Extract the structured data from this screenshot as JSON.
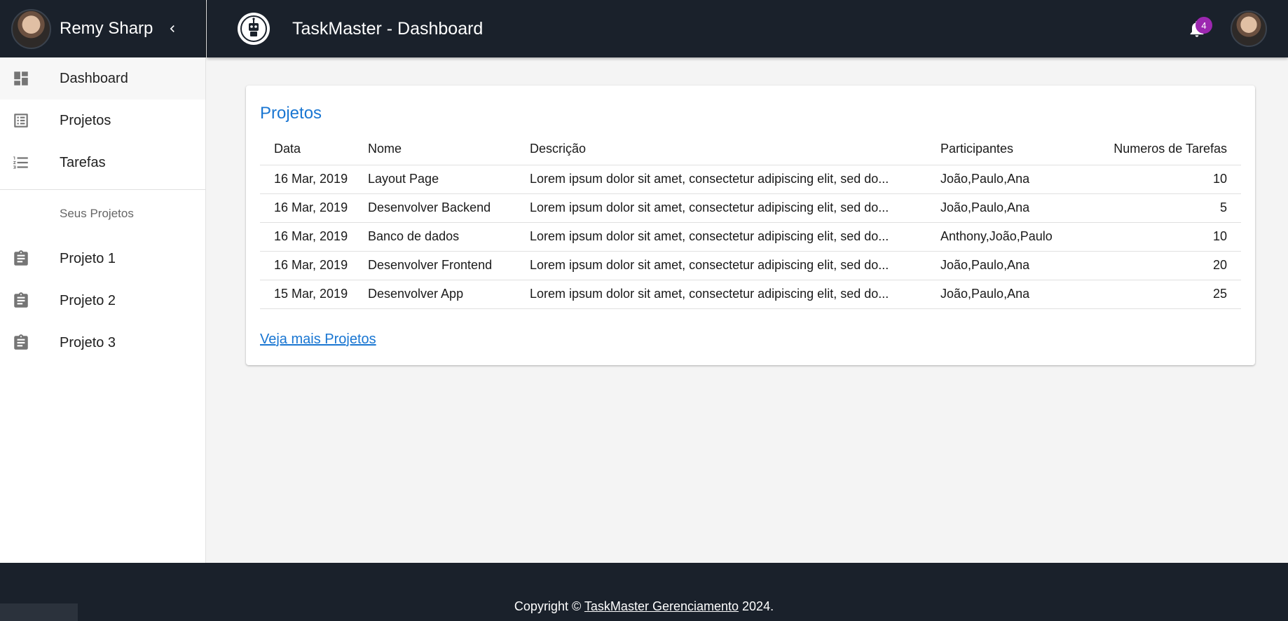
{
  "sidebar": {
    "user_name": "Remy Sharp",
    "nav": [
      {
        "label": "Dashboard",
        "icon": "dashboard-icon"
      },
      {
        "label": "Projetos",
        "icon": "list-alt-icon"
      },
      {
        "label": "Tarefas",
        "icon": "format-list-numbered-icon"
      }
    ],
    "section_label": "Seus Projetos",
    "projects": [
      {
        "label": "Projeto 1",
        "icon": "assignment-icon"
      },
      {
        "label": "Projeto 2",
        "icon": "assignment-icon"
      },
      {
        "label": "Projeto 3",
        "icon": "assignment-icon"
      }
    ]
  },
  "appbar": {
    "title": "TaskMaster - Dashboard",
    "notification_count": "4"
  },
  "projects_card": {
    "title": "Projetos",
    "columns": [
      "Data",
      "Nome",
      "Descrição",
      "Participantes",
      "Numeros de Tarefas"
    ],
    "rows": [
      [
        "16 Mar, 2019",
        "Layout Page",
        "Lorem ipsum dolor sit amet, consectetur adipiscing elit, sed do...",
        "João,Paulo,Ana",
        "10"
      ],
      [
        "16 Mar, 2019",
        "Desenvolver Backend",
        "Lorem ipsum dolor sit amet, consectetur adipiscing elit, sed do...",
        "João,Paulo,Ana",
        "5"
      ],
      [
        "16 Mar, 2019",
        "Banco de dados",
        "Lorem ipsum dolor sit amet, consectetur adipiscing elit, sed do...",
        "Anthony,João,Paulo",
        "10"
      ],
      [
        "16 Mar, 2019",
        "Desenvolver Frontend",
        "Lorem ipsum dolor sit amet, consectetur adipiscing elit, sed do...",
        "João,Paulo,Ana",
        "20"
      ],
      [
        "15 Mar, 2019",
        "Desenvolver App",
        "Lorem ipsum dolor sit amet, consectetur adipiscing elit, sed do...",
        "João,Paulo,Ana",
        "25"
      ]
    ],
    "more_link": "Veja mais Projetos"
  },
  "footer": {
    "prefix": "Copyright ©",
    "link": "TaskMaster Gerenciamento",
    "suffix": "2024."
  },
  "colors": {
    "bar": "#1a212b",
    "accent": "#1976d2",
    "badge": "#9c27b0"
  }
}
